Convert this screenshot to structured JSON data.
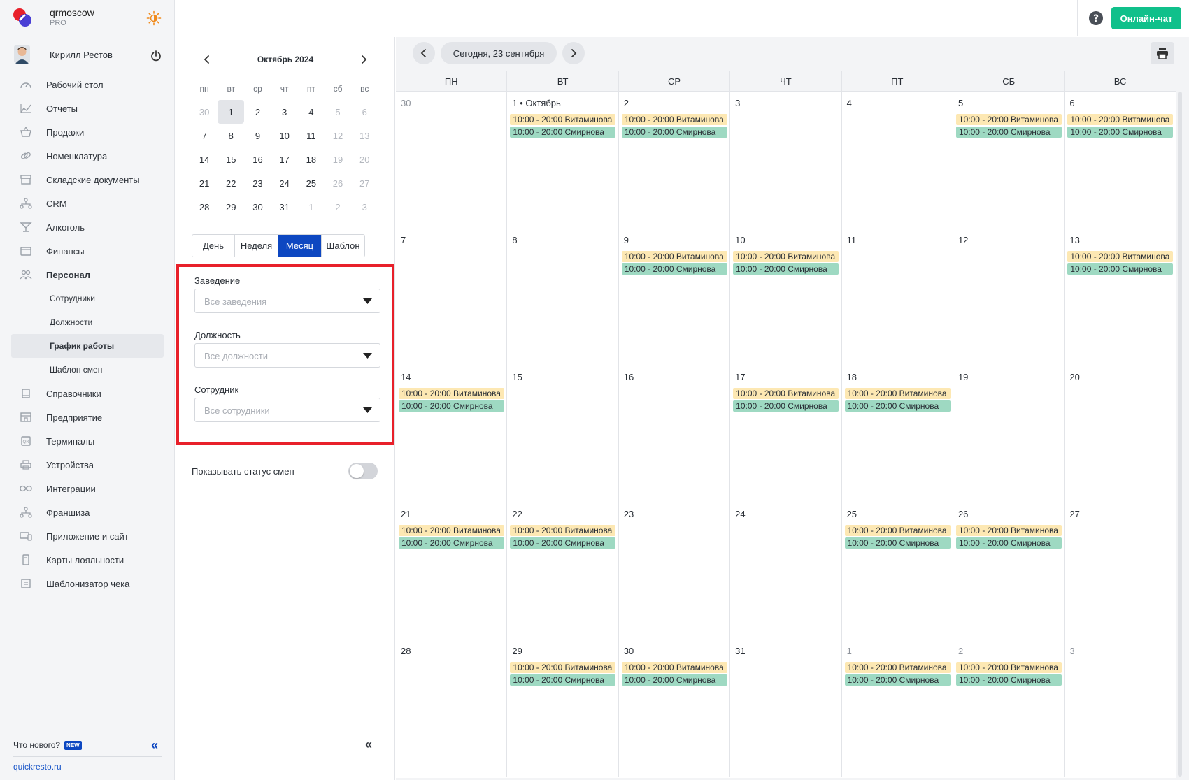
{
  "brand": {
    "name": "qrmoscow",
    "plan": "PRO"
  },
  "user": {
    "name": "Кирилл Рестов"
  },
  "nav": {
    "items": [
      {
        "label": "Рабочий стол",
        "icon": "dashboard-icon"
      },
      {
        "label": "Отчеты",
        "icon": "chart-icon"
      },
      {
        "label": "Продажи",
        "icon": "basket-icon"
      },
      {
        "label": "Номенклатура",
        "icon": "link-icon"
      },
      {
        "label": "Складские документы",
        "icon": "archive-icon"
      },
      {
        "label": "CRM",
        "icon": "hierarchy-icon"
      },
      {
        "label": "Алкоголь",
        "icon": "cocktail-icon"
      },
      {
        "label": "Финансы",
        "icon": "wallet-icon"
      },
      {
        "label": "Персонал",
        "icon": "people-icon"
      }
    ],
    "sub": [
      {
        "label": "Сотрудники"
      },
      {
        "label": "Должности"
      },
      {
        "label": "График работы"
      },
      {
        "label": "Шаблон смен"
      }
    ],
    "items2": [
      {
        "label": "Справочники",
        "icon": "book-icon"
      },
      {
        "label": "Предприятие",
        "icon": "store-icon"
      },
      {
        "label": "Терминалы",
        "icon": "terminal-icon"
      },
      {
        "label": "Устройства",
        "icon": "printer-icon"
      },
      {
        "label": "Интеграции",
        "icon": "infinity-icon"
      },
      {
        "label": "Франшиза",
        "icon": "franchise-icon"
      },
      {
        "label": "Приложение и сайт",
        "icon": "devices-icon"
      },
      {
        "label": "Карты лояльности",
        "icon": "card-icon"
      },
      {
        "label": "Шаблонизатор чека",
        "icon": "receipt-icon"
      }
    ]
  },
  "footer": {
    "whats_new": "Что нового?",
    "new_badge": "NEW",
    "site": "quickresto.ru"
  },
  "header": {
    "chat_button": "Онлайн-чат"
  },
  "mini_calendar": {
    "title": "Октябрь 2024",
    "weekdays": [
      "пн",
      "вт",
      "ср",
      "чт",
      "пт",
      "сб",
      "вс"
    ],
    "weeks": [
      [
        "30",
        "1",
        "2",
        "3",
        "4",
        "5",
        "6"
      ],
      [
        "7",
        "8",
        "9",
        "10",
        "11",
        "12",
        "13"
      ],
      [
        "14",
        "15",
        "16",
        "17",
        "18",
        "19",
        "20"
      ],
      [
        "21",
        "22",
        "23",
        "24",
        "25",
        "26",
        "27"
      ],
      [
        "28",
        "29",
        "30",
        "31",
        "1",
        "2",
        "3"
      ]
    ]
  },
  "views": [
    "День",
    "Неделя",
    "Месяц",
    "Шаблон"
  ],
  "active_view": "Месяц",
  "filters": {
    "venue": {
      "label": "Заведение",
      "placeholder": "Все заведения"
    },
    "position": {
      "label": "Должность",
      "placeholder": "Все должности"
    },
    "employee": {
      "label": "Сотрудник",
      "placeholder": "Все сотрудники"
    }
  },
  "show_status": {
    "label": "Показывать статус смен",
    "enabled": false
  },
  "main": {
    "today_label": "Сегодня, 23 сентября",
    "weekdays": [
      "ПН",
      "ВТ",
      "СР",
      "ЧТ",
      "ПТ",
      "СБ",
      "ВС"
    ],
    "shift_a": "10:00 - 20:00 Витаминова",
    "shift_b": "10:00 - 20:00 Смирнова",
    "weeks": [
      [
        {
          "day": "30",
          "other": true,
          "shifts": false
        },
        {
          "day": "1 • Октябрь",
          "shifts": true
        },
        {
          "day": "2",
          "shifts": true
        },
        {
          "day": "3",
          "shifts": false
        },
        {
          "day": "4",
          "shifts": false
        },
        {
          "day": "5",
          "shifts": true
        },
        {
          "day": "6",
          "shifts": true
        }
      ],
      [
        {
          "day": "7",
          "shifts": false
        },
        {
          "day": "8",
          "shifts": false
        },
        {
          "day": "9",
          "shifts": true
        },
        {
          "day": "10",
          "shifts": true
        },
        {
          "day": "11",
          "shifts": false
        },
        {
          "day": "12",
          "shifts": false
        },
        {
          "day": "13",
          "shifts": true
        }
      ],
      [
        {
          "day": "14",
          "shifts": true
        },
        {
          "day": "15",
          "shifts": false
        },
        {
          "day": "16",
          "shifts": false
        },
        {
          "day": "17",
          "shifts": true
        },
        {
          "day": "18",
          "shifts": true
        },
        {
          "day": "19",
          "shifts": false
        },
        {
          "day": "20",
          "shifts": false
        }
      ],
      [
        {
          "day": "21",
          "shifts": true
        },
        {
          "day": "22",
          "shifts": true
        },
        {
          "day": "23",
          "shifts": false
        },
        {
          "day": "24",
          "shifts": false
        },
        {
          "day": "25",
          "shifts": true
        },
        {
          "day": "26",
          "shifts": true
        },
        {
          "day": "27",
          "shifts": false
        }
      ],
      [
        {
          "day": "28",
          "shifts": false
        },
        {
          "day": "29",
          "shifts": true
        },
        {
          "day": "30",
          "shifts": true
        },
        {
          "day": "31",
          "shifts": false
        },
        {
          "day": "1",
          "other": true,
          "shifts": true
        },
        {
          "day": "2",
          "other": true,
          "shifts": true
        },
        {
          "day": "3",
          "other": true,
          "shifts": false
        }
      ]
    ]
  },
  "colors": {
    "accent": "#0d47c1",
    "chat": "#10c08b",
    "highlight_border": "#e8202a",
    "shift_a": "#fde8b3",
    "shift_b": "#9ed9c2"
  }
}
